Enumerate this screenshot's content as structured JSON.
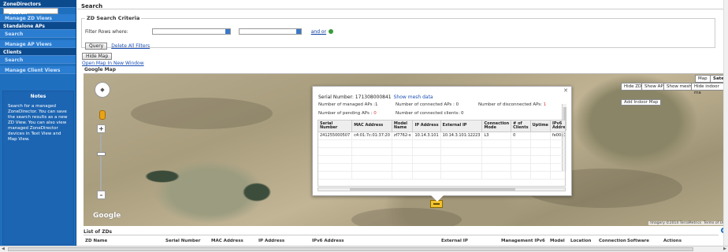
{
  "sidebar": {
    "sections": [
      {
        "head": "ZoneDirectors",
        "items": [
          "Search",
          "Manage ZD Views"
        ]
      },
      {
        "head": "Standalone APs",
        "items": [
          "Search",
          "Manage AP Views"
        ]
      },
      {
        "head": "Clients",
        "items": [
          "Search",
          "Manage Client Views"
        ]
      }
    ],
    "notes_title": "Notes",
    "notes_body": "Search for a managed ZoneDirector. You can save the search results as a new ZD View. You can also view managed ZoneDirector devices in Text View and Map View."
  },
  "main": {
    "title": "Search",
    "criteria": {
      "legend": "ZD Search Criteria",
      "filter_label": "Filter Rows where:",
      "and_or": "and  or",
      "query_label": "Query",
      "delete_label": "Delete All Filters"
    },
    "hide_map_label": "Hide Map",
    "open_map_label": "Open Map In New Window",
    "google_map_label": "Google Map"
  },
  "map": {
    "type_buttons": [
      "Map",
      "Satellite"
    ],
    "side_buttons": [
      "Hide ZD",
      "Show AP",
      "Show mesh",
      "Hide indoor ma"
    ],
    "add_indoor_label": "Add Indoor Map",
    "attribution": [
      "Imagery ©2014 TerraMetrics",
      "Terms of Use"
    ],
    "google_logo": "Google"
  },
  "infowindow": {
    "serial_label": "Serial Number: 171308000841",
    "show_mesh": "Show mesh data",
    "managed_aps": "Number of managed APs :1",
    "connected_aps_label": "Number of connected APs",
    "connected_aps_value": ": 0",
    "disconnected_aps_label": "Number of disconnected APs:",
    "disconnected_aps_value": "1",
    "pending_aps_label": "Number of pending APs :",
    "pending_aps_value": "0",
    "connected_clients": "Number of connected clients: 0",
    "columns": [
      "Serial Number",
      "MAC Address",
      "Model Name",
      "IP Address",
      "External IP",
      "Connection Mode",
      "# of Clients",
      "Uptime",
      "IPv6 Addres"
    ],
    "rows": [
      [
        "241255000507",
        "c4:01:7c:01:37:20",
        "zf7762-s",
        "10.14.3.101",
        "10.14.3.101:12223",
        "L3",
        "0",
        "",
        "fe00::1"
      ]
    ]
  },
  "list": {
    "title": "List of ZDs",
    "columns": [
      "ZD Name",
      "Serial Number",
      "MAC Address",
      "IP Address",
      "IPv6 Address",
      "External IP",
      "Management IPv6",
      "Model",
      "Location",
      "Connection",
      "Software",
      "Actions"
    ]
  }
}
